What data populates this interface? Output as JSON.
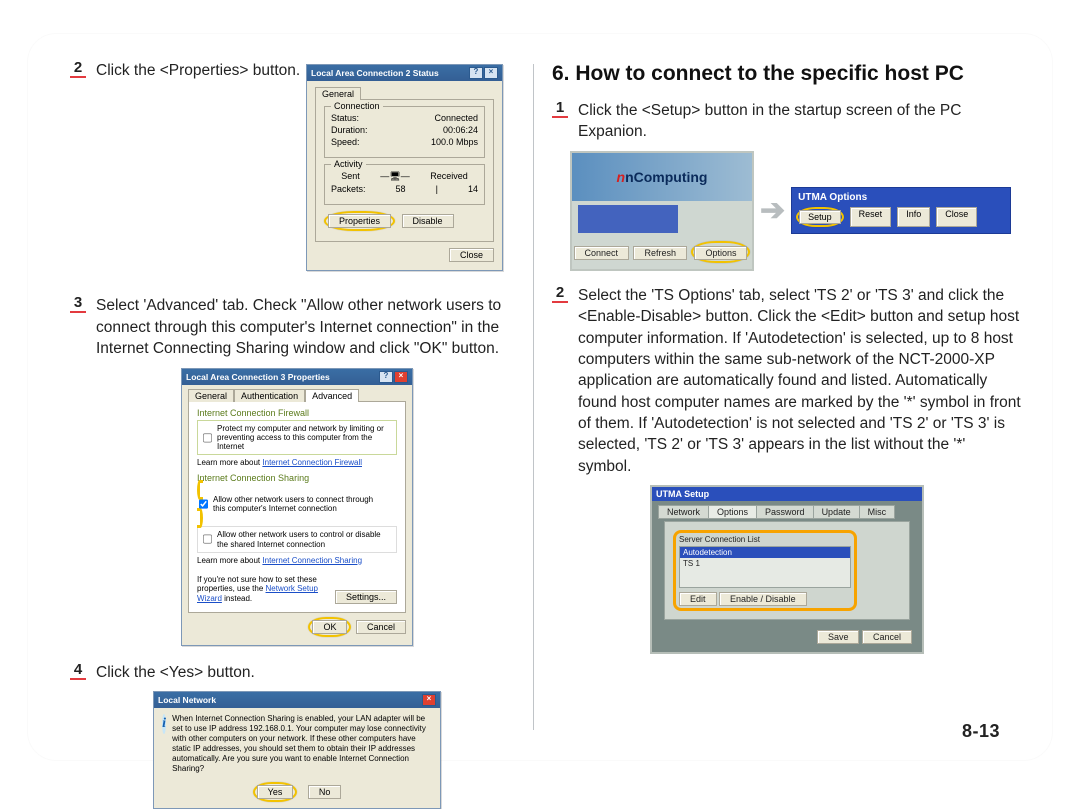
{
  "pageNumber": "8-13",
  "left": {
    "steps": {
      "2": {
        "num": "2",
        "text": "Click the <Properties> button."
      },
      "3": {
        "num": "3",
        "text": "Select 'Advanced' tab. Check \"Allow other network users to connect through this computer's Internet connection\" in the Internet Connecting Sharing window and click \"OK\" button."
      },
      "4": {
        "num": "4",
        "text": "Click the <Yes> button."
      }
    }
  },
  "right": {
    "title": "6. How to connect to the specific host PC",
    "steps": {
      "1": {
        "num": "1",
        "text": "Click the <Setup> button in the startup screen of the PC Expanion."
      },
      "2": {
        "num": "2",
        "text": "Select the 'TS Options' tab, select 'TS 2' or 'TS 3' and click the <Enable-Disable> button. Click the <Edit> button and setup host computer information. If 'Autodetection' is selected, up to 8 host computers within the same sub-network of the NCT-2000-XP application are automatically found and listed. Automatically found host computer names are marked by the '*' symbol in front of them. If 'Autodetection' is not selected and 'TS 2' or 'TS 3' is selected, 'TS 2' or 'TS 3' appears in the list without the '*' symbol."
      }
    }
  },
  "fig1": {
    "title": "Local Area Connection 2 Status",
    "tab": "General",
    "grpA": "Connection",
    "statusLbl": "Status:",
    "statusVal": "Connected",
    "durLbl": "Duration:",
    "durVal": "00:06:24",
    "spdLbl": "Speed:",
    "spdVal": "100.0 Mbps",
    "grpB": "Activity",
    "sent": "Sent",
    "recv": "Received",
    "pktsLbl": "Packets:",
    "pktsSent": "58",
    "pktsRecv": "14",
    "btnProp": "Properties",
    "btnDis": "Disable",
    "btnClose": "Close"
  },
  "fig2": {
    "title": "Local Area Connection 3 Properties",
    "tabs": [
      "General",
      "Authentication",
      "Advanced"
    ],
    "icfHead": "Internet Connection Firewall",
    "icfChk": "Protect my computer and network by limiting or preventing access to this computer from the Internet",
    "icfLearn": "Learn more about",
    "icfLink": "Internet Connection Firewall",
    "icsHead": "Internet Connection Sharing",
    "icsChk1": "Allow other network users to connect through this computer's Internet connection",
    "icsChk2": "Allow other network users to control or disable the shared Internet connection",
    "icsLearn": "Learn more about",
    "icsLink": "Internet Connection Sharing",
    "hint1": "If you're not sure how to set these properties, use",
    "hint2": "the",
    "hintLink": "Network Setup Wizard",
    "hint3": "instead.",
    "btnSettings": "Settings...",
    "btnOK": "OK",
    "btnCancel": "Cancel"
  },
  "fig3": {
    "title": "Local Network",
    "msg": "When Internet Connection Sharing is enabled, your LAN adapter will be set to use IP address 192.168.0.1. Your computer may lose connectivity with other computers on your network. If these other computers have static IP addresses, you should set them to obtain their IP addresses automatically. Are you sure you want to enable Internet Connection Sharing?",
    "btnYes": "Yes",
    "btnNo": "No"
  },
  "fig4": {
    "brand": "nComputing",
    "btnConnect": "Connect",
    "btnRefresh": "Refresh",
    "btnOptions": "Options",
    "utmaTitle": "UTMA Options",
    "btnSetup": "Setup",
    "btnReset": "Reset",
    "btnInfo": "Info",
    "btnClose": "Close"
  },
  "fig5": {
    "title": "UTMA Setup",
    "tabs": [
      "Network",
      "Options",
      "Password",
      "Update",
      "Misc"
    ],
    "listLabel": "Server Connection List",
    "row1": "Autodetection",
    "row2": "TS 1",
    "btnEdit": "Edit",
    "btnEnable": "Enable / Disable",
    "btnSave": "Save",
    "btnCancel": "Cancel"
  }
}
